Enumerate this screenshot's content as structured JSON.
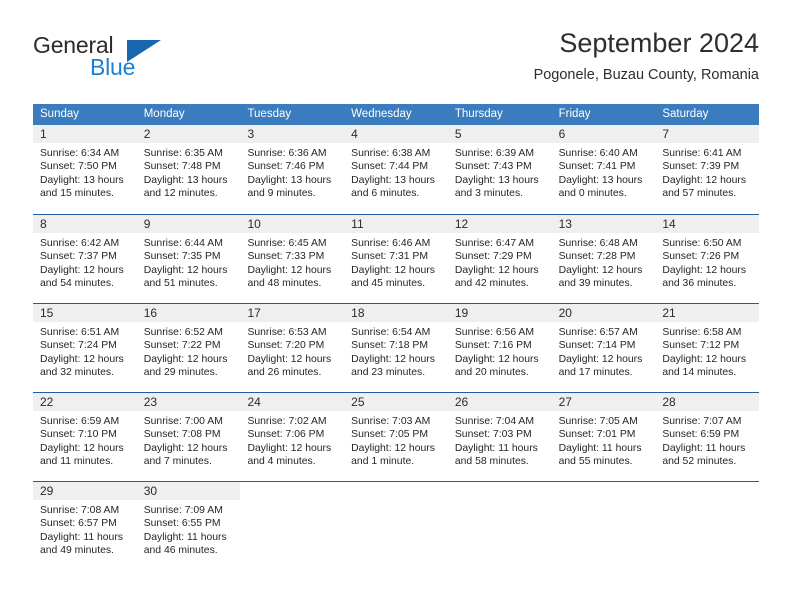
{
  "brand": {
    "name_top": "General",
    "name_bottom": "Blue",
    "triangle_color": "#1667b0",
    "blue_text_color": "#1b7fd4"
  },
  "header": {
    "title": "September 2024",
    "subtitle": "Pogonele, Buzau County, Romania"
  },
  "theme": {
    "header_bg": "#3a7cbe",
    "row_divider": "#1f5fa0",
    "daynum_band_bg": "#efefef"
  },
  "weekdays": [
    "Sunday",
    "Monday",
    "Tuesday",
    "Wednesday",
    "Thursday",
    "Friday",
    "Saturday"
  ],
  "weeks": [
    [
      {
        "day": "1",
        "lines": [
          "Sunrise: 6:34 AM",
          "Sunset: 7:50 PM",
          "Daylight: 13 hours",
          "and 15 minutes."
        ]
      },
      {
        "day": "2",
        "lines": [
          "Sunrise: 6:35 AM",
          "Sunset: 7:48 PM",
          "Daylight: 13 hours",
          "and 12 minutes."
        ]
      },
      {
        "day": "3",
        "lines": [
          "Sunrise: 6:36 AM",
          "Sunset: 7:46 PM",
          "Daylight: 13 hours",
          "and 9 minutes."
        ]
      },
      {
        "day": "4",
        "lines": [
          "Sunrise: 6:38 AM",
          "Sunset: 7:44 PM",
          "Daylight: 13 hours",
          "and 6 minutes."
        ]
      },
      {
        "day": "5",
        "lines": [
          "Sunrise: 6:39 AM",
          "Sunset: 7:43 PM",
          "Daylight: 13 hours",
          "and 3 minutes."
        ]
      },
      {
        "day": "6",
        "lines": [
          "Sunrise: 6:40 AM",
          "Sunset: 7:41 PM",
          "Daylight: 13 hours",
          "and 0 minutes."
        ]
      },
      {
        "day": "7",
        "lines": [
          "Sunrise: 6:41 AM",
          "Sunset: 7:39 PM",
          "Daylight: 12 hours",
          "and 57 minutes."
        ]
      }
    ],
    [
      {
        "day": "8",
        "lines": [
          "Sunrise: 6:42 AM",
          "Sunset: 7:37 PM",
          "Daylight: 12 hours",
          "and 54 minutes."
        ]
      },
      {
        "day": "9",
        "lines": [
          "Sunrise: 6:44 AM",
          "Sunset: 7:35 PM",
          "Daylight: 12 hours",
          "and 51 minutes."
        ]
      },
      {
        "day": "10",
        "lines": [
          "Sunrise: 6:45 AM",
          "Sunset: 7:33 PM",
          "Daylight: 12 hours",
          "and 48 minutes."
        ]
      },
      {
        "day": "11",
        "lines": [
          "Sunrise: 6:46 AM",
          "Sunset: 7:31 PM",
          "Daylight: 12 hours",
          "and 45 minutes."
        ]
      },
      {
        "day": "12",
        "lines": [
          "Sunrise: 6:47 AM",
          "Sunset: 7:29 PM",
          "Daylight: 12 hours",
          "and 42 minutes."
        ]
      },
      {
        "day": "13",
        "lines": [
          "Sunrise: 6:48 AM",
          "Sunset: 7:28 PM",
          "Daylight: 12 hours",
          "and 39 minutes."
        ]
      },
      {
        "day": "14",
        "lines": [
          "Sunrise: 6:50 AM",
          "Sunset: 7:26 PM",
          "Daylight: 12 hours",
          "and 36 minutes."
        ]
      }
    ],
    [
      {
        "day": "15",
        "lines": [
          "Sunrise: 6:51 AM",
          "Sunset: 7:24 PM",
          "Daylight: 12 hours",
          "and 32 minutes."
        ]
      },
      {
        "day": "16",
        "lines": [
          "Sunrise: 6:52 AM",
          "Sunset: 7:22 PM",
          "Daylight: 12 hours",
          "and 29 minutes."
        ]
      },
      {
        "day": "17",
        "lines": [
          "Sunrise: 6:53 AM",
          "Sunset: 7:20 PM",
          "Daylight: 12 hours",
          "and 26 minutes."
        ]
      },
      {
        "day": "18",
        "lines": [
          "Sunrise: 6:54 AM",
          "Sunset: 7:18 PM",
          "Daylight: 12 hours",
          "and 23 minutes."
        ]
      },
      {
        "day": "19",
        "lines": [
          "Sunrise: 6:56 AM",
          "Sunset: 7:16 PM",
          "Daylight: 12 hours",
          "and 20 minutes."
        ]
      },
      {
        "day": "20",
        "lines": [
          "Sunrise: 6:57 AM",
          "Sunset: 7:14 PM",
          "Daylight: 12 hours",
          "and 17 minutes."
        ]
      },
      {
        "day": "21",
        "lines": [
          "Sunrise: 6:58 AM",
          "Sunset: 7:12 PM",
          "Daylight: 12 hours",
          "and 14 minutes."
        ]
      }
    ],
    [
      {
        "day": "22",
        "lines": [
          "Sunrise: 6:59 AM",
          "Sunset: 7:10 PM",
          "Daylight: 12 hours",
          "and 11 minutes."
        ]
      },
      {
        "day": "23",
        "lines": [
          "Sunrise: 7:00 AM",
          "Sunset: 7:08 PM",
          "Daylight: 12 hours",
          "and 7 minutes."
        ]
      },
      {
        "day": "24",
        "lines": [
          "Sunrise: 7:02 AM",
          "Sunset: 7:06 PM",
          "Daylight: 12 hours",
          "and 4 minutes."
        ]
      },
      {
        "day": "25",
        "lines": [
          "Sunrise: 7:03 AM",
          "Sunset: 7:05 PM",
          "Daylight: 12 hours",
          "and 1 minute."
        ]
      },
      {
        "day": "26",
        "lines": [
          "Sunrise: 7:04 AM",
          "Sunset: 7:03 PM",
          "Daylight: 11 hours",
          "and 58 minutes."
        ]
      },
      {
        "day": "27",
        "lines": [
          "Sunrise: 7:05 AM",
          "Sunset: 7:01 PM",
          "Daylight: 11 hours",
          "and 55 minutes."
        ]
      },
      {
        "day": "28",
        "lines": [
          "Sunrise: 7:07 AM",
          "Sunset: 6:59 PM",
          "Daylight: 11 hours",
          "and 52 minutes."
        ]
      }
    ],
    [
      {
        "day": "29",
        "lines": [
          "Sunrise: 7:08 AM",
          "Sunset: 6:57 PM",
          "Daylight: 11 hours",
          "and 49 minutes."
        ]
      },
      {
        "day": "30",
        "lines": [
          "Sunrise: 7:09 AM",
          "Sunset: 6:55 PM",
          "Daylight: 11 hours",
          "and 46 minutes."
        ]
      },
      {
        "day": "",
        "lines": []
      },
      {
        "day": "",
        "lines": []
      },
      {
        "day": "",
        "lines": []
      },
      {
        "day": "",
        "lines": []
      },
      {
        "day": "",
        "lines": []
      }
    ]
  ]
}
